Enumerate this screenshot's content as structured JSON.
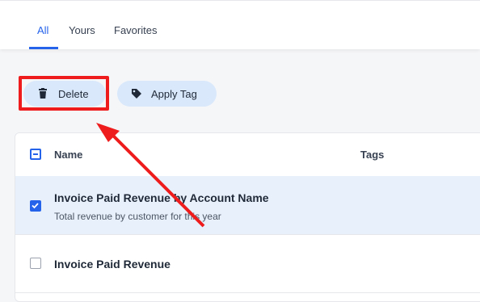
{
  "tabs": [
    {
      "label": "All",
      "active": true
    },
    {
      "label": "Yours",
      "active": false
    },
    {
      "label": "Favorites",
      "active": false
    }
  ],
  "toolbar": {
    "delete_label": "Delete",
    "apply_tag_label": "Apply Tag"
  },
  "table": {
    "columns": {
      "name": "Name",
      "tags": "Tags"
    },
    "rows": [
      {
        "title": "Invoice Paid Revenue by Account Name",
        "subtitle": "Total revenue by customer for this year",
        "checked": true
      },
      {
        "title": "Invoice Paid Revenue",
        "subtitle": "",
        "checked": false
      }
    ]
  },
  "colors": {
    "accent": "#2563eb",
    "annotation": "#ee1c1c",
    "selected_row": "#e8f0fc",
    "button_bg": "#d9e8fb"
  },
  "icons": {
    "delete": "trash-icon",
    "apply_tag": "tag-icon"
  }
}
